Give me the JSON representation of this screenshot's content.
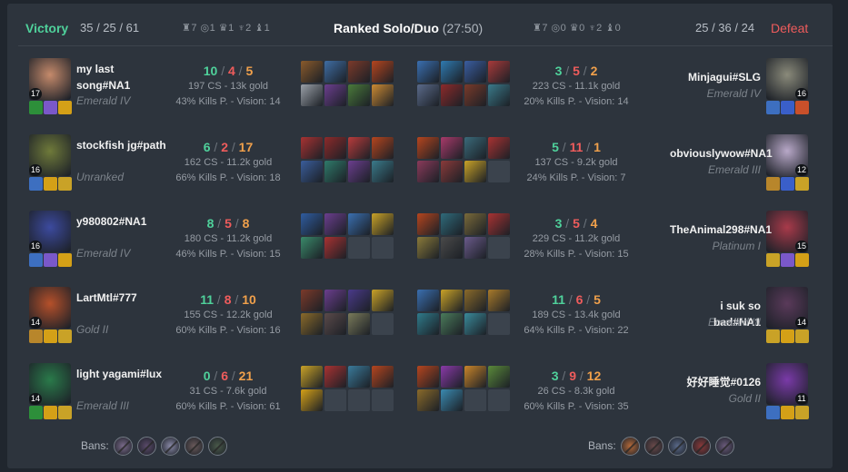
{
  "header": {
    "left_result": "Victory",
    "left_kda": "35 / 25 / 61",
    "left_objectives": "♜7 ◎1 ♛1 ♆2 ♝1",
    "queue": "Ranked Solo/Duo",
    "duration": "(27:50)",
    "right_objectives": "♜7 ◎0 ♛0 ♆2 ♝0",
    "right_kda": "25 / 36 / 24",
    "right_result": "Defeat"
  },
  "left_team": [
    {
      "name": "my last song#NA1",
      "rank": "Emerald IV",
      "level": "17",
      "k": "10",
      "d": "4",
      "a": "5",
      "cs": "197 CS - 13k gold",
      "kp": "43% Kills P. - Vision: 14",
      "champ_color": "#c58a6b",
      "spell_colors": [
        "#2d8f3a",
        "#7a58c9",
        "#d4a017"
      ],
      "item_colors": [
        "#8a5a2b",
        "#3f6da3",
        "#7c3a2a",
        "#b5451e",
        "#9aa0a8",
        "#6b3e8e",
        "#4a7a3a",
        "#cc8a33"
      ]
    },
    {
      "name": "stockfish jg#path",
      "rank": "Unranked",
      "level": "16",
      "k": "6",
      "d": "2",
      "a": "17",
      "cs": "162 CS - 11.2k gold",
      "kp": "66% Kills P. - Vision: 18",
      "champ_color": "#6f7a3a",
      "spell_colors": [
        "#3d6fc0",
        "#d4a017",
        "#c9a227"
      ],
      "item_colors": [
        "#a83232",
        "#8d2a2a",
        "#b83b3b",
        "#b5451e",
        "#3a5d9b",
        "#2f7a6a",
        "#6b3e8e",
        "#3a7a8a"
      ]
    },
    {
      "name": "y980802#NA1",
      "rank": "Emerald IV",
      "level": "16",
      "k": "8",
      "d": "5",
      "a": "8",
      "cs": "180 CS - 11.2k gold",
      "kp": "46% Kills P. - Vision: 15",
      "champ_color": "#3c4a9e",
      "spell_colors": [
        "#3d6fc0",
        "#7a58c9",
        "#d4a017"
      ],
      "item_colors": [
        "#2f5ca0",
        "#6b3e8e",
        "#3a6fb0",
        "#c9a227",
        "#3a8a6a",
        "#a83232",
        "",
        ""
      ]
    },
    {
      "name": "LartMtl#777",
      "rank": "Gold II",
      "level": "14",
      "k": "11",
      "d": "8",
      "a": "10",
      "cs": "155 CS - 12.2k gold",
      "kp": "60% Kills P. - Vision: 16",
      "champ_color": "#b5502a",
      "spell_colors": [
        "#b8862b",
        "#d4a017",
        "#c9a227"
      ],
      "item_colors": [
        "#7c3a2a",
        "#6b3e8e",
        "#4a3a8a",
        "#c9a227",
        "#8a6a2a",
        "#5a4a4a",
        "#7a7a5a",
        ""
      ]
    },
    {
      "name": "light yagami#lux",
      "rank": "Emerald III",
      "level": "14",
      "k": "0",
      "d": "6",
      "a": "21",
      "cs": "31 CS - 7.6k gold",
      "kp": "60% Kills P. - Vision: 61",
      "champ_color": "#2a7a4a",
      "spell_colors": [
        "#2d8f3a",
        "#d4a017",
        "#c9a227"
      ],
      "item_colors": [
        "#c9a227",
        "#a83232",
        "#3a7a9a",
        "#b5451e",
        "#d4a017",
        "",
        "",
        ""
      ]
    }
  ],
  "right_team": [
    {
      "name": "Minjagui#SLG",
      "rank": "Emerald IV",
      "level": "16",
      "k": "3",
      "d": "5",
      "a": "2",
      "cs": "223 CS - 11.1k gold",
      "kp": "20% Kills P. - Vision: 14",
      "champ_color": "#8a8a7a",
      "spell_colors": [
        "#3d6fc0",
        "#3a5fc9",
        "#c9502a"
      ],
      "item_colors": [
        "#3a6fb0",
        "#2f7ab0",
        "#3a5da0",
        "#a83a3a",
        "#5a6a8a",
        "#8d2a2a",
        "#7a3a2a",
        "#3a7a8a"
      ]
    },
    {
      "name": "obviouslywow#NA1",
      "rank": "Emerald III",
      "level": "12",
      "k": "5",
      "d": "11",
      "a": "1",
      "cs": "137 CS - 9.2k gold",
      "kp": "24% Kills P. - Vision: 7",
      "champ_color": "#b8a8c8",
      "spell_colors": [
        "#b8862b",
        "#3a5fc9",
        "#c9a227"
      ],
      "item_colors": [
        "#b5451e",
        "#a83a6a",
        "#3a6a7a",
        "#a83232",
        "#8a3a5a",
        "#8a3a3a",
        "#c9a227",
        ""
      ]
    },
    {
      "name": "TheAnimal298#NA1",
      "rank": "Platinum I",
      "level": "15",
      "k": "3",
      "d": "5",
      "a": "4",
      "cs": "229 CS - 11.2k gold",
      "kp": "28% Kills P. - Vision: 15",
      "champ_color": "#a83a4a",
      "spell_colors": [
        "#c9a227",
        "#7a58c9",
        "#d4a017"
      ],
      "item_colors": [
        "#b5451e",
        "#2f6a7a",
        "#7a6a3a",
        "#a83232",
        "#8a7a3a",
        "#4a4a4a",
        "#6a5a8a",
        ""
      ]
    },
    {
      "name": "i suk so bad#NA1",
      "rank": "Emerald III",
      "level": "14",
      "k": "11",
      "d": "6",
      "a": "5",
      "cs": "189 CS - 13.4k gold",
      "kp": "64% Kills P. - Vision: 22",
      "champ_color": "#5a3a5a",
      "spell_colors": [
        "#c9a227",
        "#d4a017",
        "#c9a227"
      ],
      "item_colors": [
        "#3a6fb0",
        "#c9a227",
        "#8a6a2a",
        "#a87a2a",
        "#2f7a8a",
        "#4a7a5a",
        "#3a8a9a",
        ""
      ]
    },
    {
      "name": "好好睡觉#0126",
      "rank": "Gold II",
      "level": "11",
      "k": "3",
      "d": "9",
      "a": "12",
      "cs": "26 CS - 8.3k gold",
      "kp": "60% Kills P. - Vision: 35",
      "champ_color": "#7a3aa8",
      "spell_colors": [
        "#3d6fc0",
        "#d4a017",
        "#c9a227"
      ],
      "item_colors": [
        "#b5451e",
        "#8a3aa8",
        "#c9852a",
        "#5a8a3a",
        "#8a6a2a",
        "#3a8ab0",
        "",
        ""
      ]
    }
  ],
  "bans": {
    "label": "Bans:",
    "left": [
      "#7a6a8a",
      "#5a4a6a",
      "#8a8aa8",
      "#6a5a5a",
      "#4a5a4a"
    ],
    "right": [
      "#b56a3a",
      "#6a4a4a",
      "#5a6a8a",
      "#8a3a3a",
      "#6a5a7a"
    ]
  }
}
